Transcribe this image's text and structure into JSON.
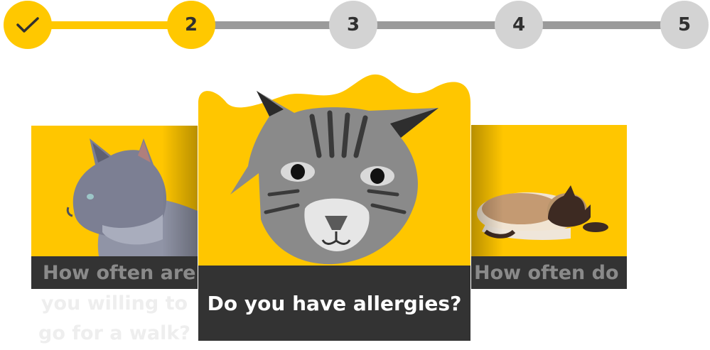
{
  "stepper": {
    "steps": [
      {
        "label": "",
        "state": "done",
        "icon": "check-icon"
      },
      {
        "label": "2",
        "state": "active"
      },
      {
        "label": "3",
        "state": "upcoming"
      },
      {
        "label": "4",
        "state": "upcoming"
      },
      {
        "label": "5",
        "state": "upcoming"
      }
    ],
    "colors": {
      "accent": "#ffc800",
      "inactive": "#d3d3d3",
      "track": "#9a9a9a"
    }
  },
  "cards": {
    "previous": {
      "question_visible": "How often are",
      "question_rest": "you willing to\ngo for a walk?",
      "image": "grey-cat-profile"
    },
    "current": {
      "question": "Do you have allergies?",
      "image": "tabby-cat-face"
    },
    "next": {
      "question": "How often do",
      "image": "siamese-cat-lying"
    }
  },
  "colors": {
    "card_background": "#ffc600",
    "caption_background": "#333333"
  }
}
